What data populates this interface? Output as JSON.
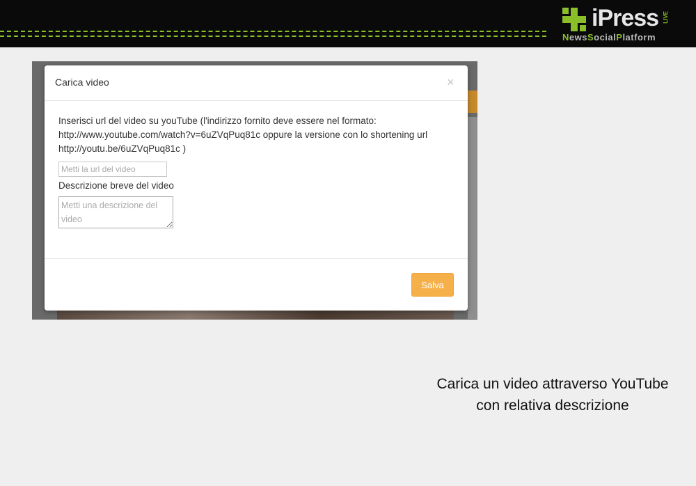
{
  "header": {
    "logo_main": "iPress",
    "logo_live": "LIVE",
    "logo_sub": {
      "part1": "N",
      "part2": "ews",
      "part3": "S",
      "part4": "ocial",
      "part5": "P",
      "part6": "latform"
    },
    "accent_color": "#8bbf2a"
  },
  "modal": {
    "title": "Carica video",
    "close_symbol": "×",
    "instructions": "Inserisci url del video su youTube (l'indirizzo fornito deve essere nel formato: http://www.youtube.com/watch?v=6uZVqPuq81c oppure la versione con lo shortening url http://youtu.be/6uZVqPuq81c )",
    "url_placeholder": "Metti la url del video",
    "url_value": "",
    "description_label": "Descrizione breve del video",
    "description_placeholder": "Metti una descrizione del video",
    "description_value": "",
    "save_label": "Salva",
    "save_color": "#f6b04a"
  },
  "caption": "Carica un video attraverso YouTube con relativa descrizione"
}
